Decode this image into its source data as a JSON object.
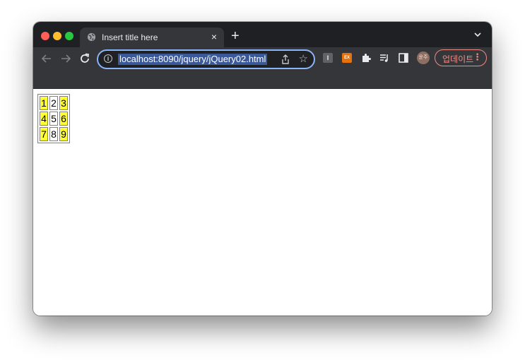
{
  "browser": {
    "tab": {
      "title": "Insert title here",
      "close_glyph": "×",
      "icon": "globe-icon"
    },
    "new_tab_glyph": "+",
    "url": "localhost:8090/jquery/jQuery02.html",
    "avatar_text": "윤주",
    "update_button": {
      "label": "업데이트",
      "dots": "⋮"
    },
    "extensions": {
      "i_label": "I",
      "ex_label": "EX"
    },
    "info_glyph": "i",
    "star_glyph": "☆",
    "colors": {
      "frame": "#1f2023",
      "toolbar": "#35363a",
      "url_focus": "#8ab4f8",
      "update": "#f28b82"
    }
  },
  "page": {
    "table": {
      "rows": [
        [
          {
            "text": "1",
            "highlight": true
          },
          {
            "text": "2",
            "highlight": false
          },
          {
            "text": "3",
            "highlight": true
          }
        ],
        [
          {
            "text": "4",
            "highlight": true
          },
          {
            "text": "5",
            "highlight": false
          },
          {
            "text": "6",
            "highlight": true
          }
        ],
        [
          {
            "text": "7",
            "highlight": true
          },
          {
            "text": "8",
            "highlight": false
          },
          {
            "text": "9",
            "highlight": true
          }
        ]
      ],
      "highlight_color": "#ffff33"
    }
  }
}
